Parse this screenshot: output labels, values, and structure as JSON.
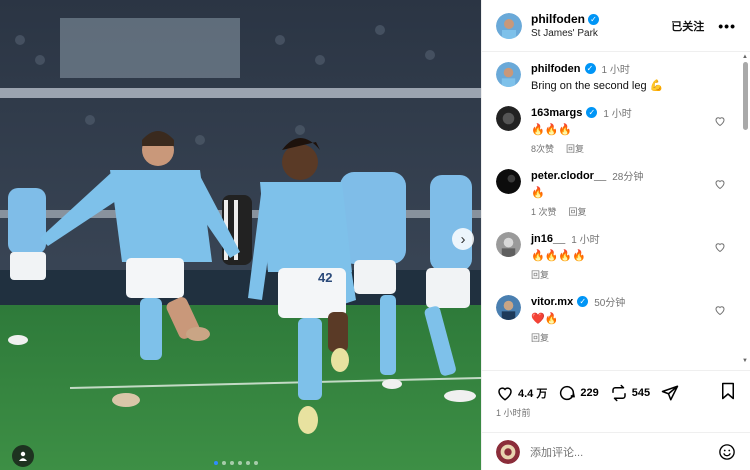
{
  "post": {
    "username": "philfoden",
    "location": "St James' Park",
    "follow_label": "已关注",
    "more_label": "•••",
    "caption": "Bring on the second leg 💪",
    "caption_time": "1 小时"
  },
  "comments": [
    {
      "user": "163margs",
      "verified": true,
      "time": "1 小时",
      "text": "🔥🔥🔥",
      "likes": "8次赞",
      "reply": "回复"
    },
    {
      "user": "peter.clodor__",
      "verified": false,
      "time": "28分钟",
      "text": "🔥",
      "likes": "1 次赞",
      "reply": "回复"
    },
    {
      "user": "jn16__",
      "verified": false,
      "time": "1 小时",
      "text": "🔥🔥🔥🔥",
      "likes": "",
      "reply": "回复"
    },
    {
      "user": "vitor.mx",
      "verified": true,
      "time": "50分钟",
      "text": "❤️🔥",
      "likes": "",
      "reply": "回复"
    }
  ],
  "actions": {
    "likes": "4.4 万",
    "comments": "229",
    "reposts": "545",
    "posted_time": "1 小时前"
  },
  "add_comment": {
    "placeholder": "添加评论..."
  },
  "carousel": {
    "current_index": 1,
    "total": 6
  },
  "icons": {
    "verified": "verified-badge-icon",
    "like": "heart-icon",
    "comment": "comment-bubble-icon",
    "repost": "repost-icon",
    "share": "send-icon",
    "save": "bookmark-icon",
    "emoji": "emoji-icon",
    "next": "chevron-right-icon",
    "user_tag": "person-icon"
  },
  "colors": {
    "verified_blue": "#0095f6",
    "meta_gray": "#737373",
    "divider": "#efefef"
  }
}
